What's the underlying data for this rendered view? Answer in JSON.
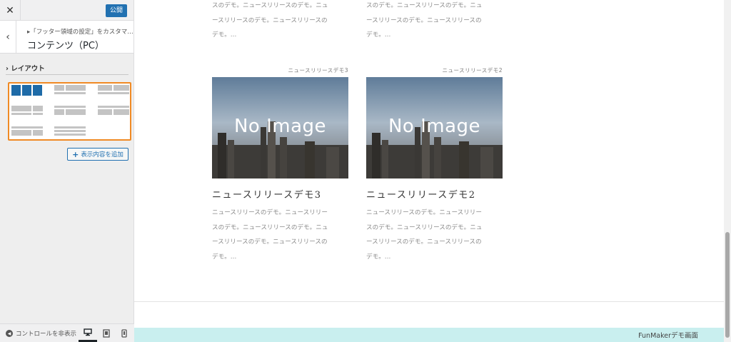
{
  "sidebar": {
    "publish_label": "公開",
    "breadcrumb": "▸「フッター領域の設定」をカスタマ…",
    "section_title": "コンテンツ（PC）",
    "layout_label": "レイアウト",
    "add_button_label": "表示内容を追加",
    "hide_controls_label": "コントロールを非表示",
    "devices": [
      "desktop",
      "tablet",
      "mobile"
    ],
    "active_device": "desktop",
    "accent_color": "#2271b1",
    "selected_outline_color": "#f08a24"
  },
  "preview": {
    "top_cards": [
      {
        "excerpt_tail": [
          "スのデモ。ニュースリリースのデモ。ニュ",
          "ースリリースのデモ。ニュースリリースの",
          "デモ。…"
        ]
      },
      {
        "excerpt_tail": [
          "スのデモ。ニュースリリースのデモ。ニュ",
          "ースリリースのデモ。ニュースリリースの",
          "デモ。…"
        ]
      }
    ],
    "cards": [
      {
        "meta": "ニュースリリースデモ3",
        "image_text": "No Image",
        "title": "ニュースリリースデモ3",
        "excerpt": [
          "ニュースリリースのデモ。ニュースリリー",
          "スのデモ。ニュースリリースのデモ。ニュ",
          "ースリリースのデモ。ニュースリリースの",
          "デモ。…"
        ]
      },
      {
        "meta": "ニュースリリースデモ2",
        "image_text": "No Image",
        "title": "ニュースリリースデモ2",
        "excerpt": [
          "ニュースリリースのデモ。ニュースリリー",
          "スのデモ。ニュースリリースのデモ。ニュ",
          "ースリリースのデモ。ニュースリリースの",
          "デモ。…"
        ]
      }
    ],
    "footer_text": "FunMakerデモ画面",
    "footer_color": "#c9efef"
  }
}
